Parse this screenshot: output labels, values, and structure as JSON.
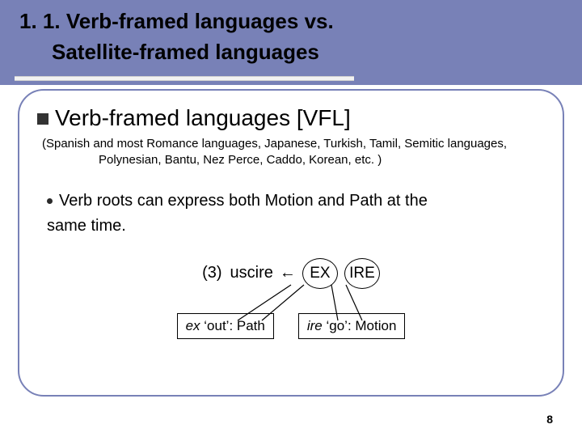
{
  "header": {
    "line1": "1. 1. Verb-framed languages vs.",
    "line2": "Satellite-framed languages"
  },
  "section": {
    "title": "Verb-framed languages [VFL]",
    "paren": "(Spanish and most Romance languages, Japanese, Turkish, Tamil, Semitic languages, Polynesian, Bantu, Nez Perce, Caddo, Korean, etc. )"
  },
  "bullet": {
    "text_l1": "Verb roots can express both Motion and Path at the",
    "text_l2": "same time."
  },
  "example": {
    "num": "(3)",
    "word": "uscire",
    "arrow": "←",
    "morph1": "EX",
    "morph2": "IRE"
  },
  "defs": {
    "left_it": "ex",
    "left_rest": " ‘out’:  Path",
    "right_it": "ire",
    "right_rest": " ‘go’: Motion"
  },
  "page": "8"
}
